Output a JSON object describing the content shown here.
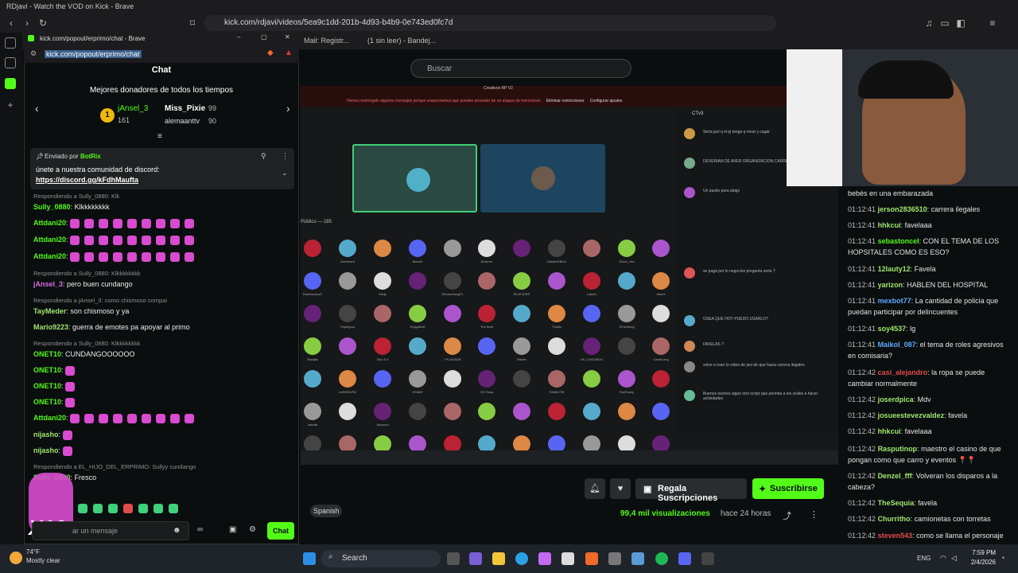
{
  "browser": {
    "window_title": "RDjavi - Watch the VOD on Kick - Brave",
    "url": "kick.com/rdjavi/videos/5ea9c1dd-201b-4d93-b4b9-0e743ed0fc7d",
    "bookmarks": [
      "Mail: Registr...",
      "(1 sin leer) - Bandej..."
    ]
  },
  "popout": {
    "window_title": "kick.com/popout/erprimo/chat - Brave",
    "url": "kick.com/popout/erprimo/chat",
    "header": "Chat",
    "donors_title": "Mejores donadores de todos los tiempos",
    "donors": [
      {
        "rank": "1",
        "name": "jAnsel_3",
        "amount": "161"
      },
      {
        "name": "Miss_Pixie",
        "amount": "99"
      },
      {
        "name": "alemaanttv",
        "amount": "90"
      }
    ],
    "pinned": {
      "by_label": "Enviado por",
      "by_user": "BotRix",
      "text": "únete a nuestra comunidad de discord:",
      "link": "https://discord.gg/kFdhMaufta"
    },
    "messages": [
      {
        "type": "reply",
        "text": "Respondiendo a Sully_0880: Klk"
      },
      {
        "type": "msg",
        "user": "Sully_0880",
        "color": "#53fc18",
        "text": "Klkkkkkkkk"
      },
      {
        "type": "msg",
        "user": "Attdani20",
        "color": "#53fc18",
        "text": ""
      },
      {
        "type": "msg",
        "user": "Attdani20",
        "color": "#53fc18",
        "text": ""
      },
      {
        "type": "msg",
        "user": "Attdani20",
        "color": "#53fc18",
        "text": ""
      },
      {
        "type": "reply",
        "text": "Respondiendo a Sully_0880: Klkkkkkkkk"
      },
      {
        "type": "msg",
        "user": "jAnsel_3",
        "color": "#d66be0",
        "text": "pero buen cundango"
      },
      {
        "type": "reply",
        "text": "Respondiendo a jAnsel_3: como chismoso compai"
      },
      {
        "type": "msg",
        "user": "TayMeder",
        "color": "#9fe870",
        "text": "son chismoso y ya"
      },
      {
        "type": "msg",
        "user": "Mario9223",
        "color": "#9fe870",
        "text": "guerra de emotes pa apoyar al primo"
      },
      {
        "type": "reply",
        "text": "Respondiendo a Sully_0880: Klkkkkkkkk"
      },
      {
        "type": "msg",
        "user": "ONET10",
        "color": "#53fc18",
        "text": "CUNDANGOOOOOO"
      },
      {
        "type": "msg",
        "user": "ONET10",
        "color": "#53fc18",
        "text": ""
      },
      {
        "type": "msg",
        "user": "ONET10",
        "color": "#53fc18",
        "text": ""
      },
      {
        "type": "msg",
        "user": "ONET10",
        "color": "#53fc18",
        "text": ""
      },
      {
        "type": "msg",
        "user": "Attdani20",
        "color": "#53fc18",
        "text": ""
      },
      {
        "type": "msg",
        "user": "nijasho",
        "color": "#9fe870",
        "text": ""
      },
      {
        "type": "msg",
        "user": "nijasho",
        "color": "#9fe870",
        "text": ""
      },
      {
        "type": "reply",
        "text": "Respondiendo a EL_HIJO_DEL_ERPRIMO: Sullyy cundango"
      },
      {
        "type": "msg",
        "user": "Sully_0880",
        "color": "#53fc18",
        "text": "Fresco"
      }
    ],
    "input_placeholder": "ar un mensaje",
    "send_label": "Chat",
    "multiplier": "X16"
  },
  "kick": {
    "search_placeholder": "Buscar",
    "subs_button": "Regala Suscripciones",
    "follow_button": "Suscribirse",
    "language": "Spanish",
    "views": "99,4 mil visualizaciones",
    "ago": "hace 24 horas"
  },
  "video": {
    "server": "Creativos RP V2",
    "notice": "Hemos restringido algunos mensajes porque sospechamos que pueden proceder de un ataque de menciones",
    "notice_btn1": "Eliminar restricciones",
    "notice_btn2": "Configurar ajustes",
    "channel": "CTv3",
    "public_label": "Público — 285",
    "chat_lines": [
      "Seria javi q el pj tenga q mear y cagar",
      "DEVERIAN DE AVER ORGANIZACION CARRERAS ILEGALES",
      "Un pasito para abajo",
      "se paga por lo negocios pregunta seria ?",
      "OSEA QUE HOY PUEDO USARLO?",
      "FAVELAS ?",
      "volve a traer lo video de javi de que hacia carrera ilegales",
      "Buenos noches algun otro script que permita a los civiles a hacer actividades"
    ],
    "avatar_names": [
      "Asesinord",
      "Baruch",
      "Brouner",
      "DawerEdition",
      "Dixon_vda",
      "DominicanoG",
      "Eddy",
      "ElbossGangF1",
      "ELVEJORP",
      "Laloch",
      "Mochi",
      "Papitopop",
      "Soygabriel",
      "The Best",
      "Trujillo",
      "XFacelong",
      "Barajita",
      "Zulu & li",
      "I PLAGADR",
      "Raidel",
      "AK_CASLINDO",
      "Carlos-img",
      "LAPARA RD",
      "OSMAY",
      "OG Sosa",
      "FAMILY05",
      "SoyFoorty",
      "kabrita",
      "Arturovd"
    ]
  },
  "rchat": {
    "partial_top": "bebés en una embarazada",
    "lines": [
      {
        "ts": "01:12:41",
        "user": "jerson2836510",
        "color": "#9fe870",
        "text": "carrera ilegales"
      },
      {
        "ts": "01:12:41",
        "user": "hhkcui",
        "color": "#9fe870",
        "text": "favelaaa"
      },
      {
        "ts": "01:12:41",
        "user": "sebastoncel",
        "color": "#53fc18",
        "text": "CON EL TEMA DE LOS HOPSITALES COMO ES ESO?"
      },
      {
        "ts": "01:12:41",
        "user": "12lauty12",
        "color": "#9fe870",
        "text": "Favela"
      },
      {
        "ts": "01:12:41",
        "user": "yarizon",
        "color": "#9fe870",
        "text": "HABLEN DEL HOSPITAL"
      },
      {
        "ts": "01:12:41",
        "user": "mexbot77",
        "color": "#5fa8ff",
        "text": "La cantidad de policia que puedan participar por delincuentes"
      },
      {
        "ts": "01:12:41",
        "user": "soy4537",
        "color": "#9fe870",
        "text": "lg"
      },
      {
        "ts": "01:12:41",
        "user": "Maikol_087",
        "color": "#5fa8ff",
        "text": "el tema de roles agresivos en comisaria?"
      },
      {
        "ts": "01:12:42",
        "user": "casi_alejandro",
        "color": "#e24b4b",
        "text": "la ropa se puede cambiar normalmente"
      },
      {
        "ts": "01:12:42",
        "user": "joserdpica",
        "color": "#9fe870",
        "text": "Mdv"
      },
      {
        "ts": "01:12:42",
        "user": "josueestevezvaldez",
        "color": "#9fe870",
        "text": "favela"
      },
      {
        "ts": "01:12:42",
        "user": "hhkcui",
        "color": "#9fe870",
        "text": "favelaaa"
      },
      {
        "ts": "01:12:42",
        "user": "Rasputinop",
        "color": "#9fe870",
        "text": "maestro el casino de que pongan como que carro y eventos 📍📍"
      },
      {
        "ts": "01:12:42",
        "user": "Denzel_fff",
        "color": "#9fe870",
        "text": "Volveran los disparos a la cabeza?"
      },
      {
        "ts": "01:12:42",
        "user": "TheSequia",
        "color": "#9fe870",
        "text": "favela"
      },
      {
        "ts": "01:12:42",
        "user": "Churritho",
        "color": "#9fe870",
        "text": "camionetas con torretas"
      },
      {
        "ts": "01:12:42",
        "user": "steven543",
        "color": "#e24b4b",
        "text": "como se llama el personaje"
      }
    ]
  },
  "taskbar": {
    "weather_temp": "74°F",
    "weather_desc": "Mostly clear",
    "search": "Search",
    "lang": "ENG",
    "time": "7:59 PM",
    "date": "2/4/2026"
  }
}
